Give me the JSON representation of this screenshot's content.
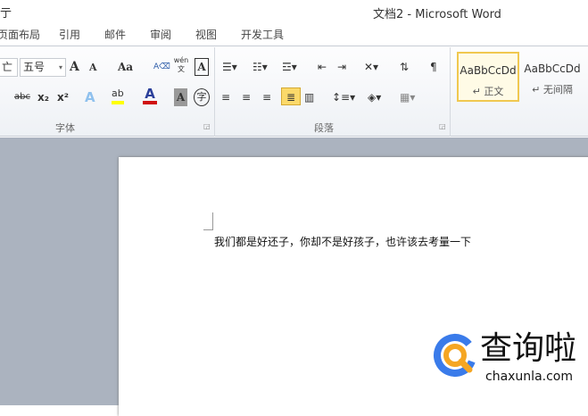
{
  "window": {
    "title": "文档2 - Microsoft Word",
    "partial_left": "亍"
  },
  "tabs": [
    "页面布局",
    "引用",
    "邮件",
    "审阅",
    "视图",
    "开发工具"
  ],
  "font_group": {
    "label": "字体",
    "font_name": "亡",
    "font_size": "五号",
    "grow": "A",
    "shrink": "A",
    "case": "Aa",
    "strike": "abc",
    "sub": "x₂",
    "sup": "x²",
    "text_effect": "A",
    "highlight": "ab",
    "font_color": "A",
    "shade": "A",
    "enclose": "字",
    "phonetic": "wén 文",
    "border_char": "A"
  },
  "paragraph_group": {
    "label": "段落"
  },
  "styles": [
    {
      "preview": "AaBbCcDd",
      "name": "正文",
      "selected": true
    },
    {
      "preview": "AaBbCcDd",
      "name": "无间隔",
      "selected": false
    }
  ],
  "document": {
    "text": "我们都是好还子，你却不是好孩子，也许该去考量一下"
  },
  "watermark": {
    "brand": "查询啦",
    "domain": "chaxunla.com",
    "colors": {
      "blue": "#3a7bea",
      "orange": "#f5a623"
    }
  }
}
